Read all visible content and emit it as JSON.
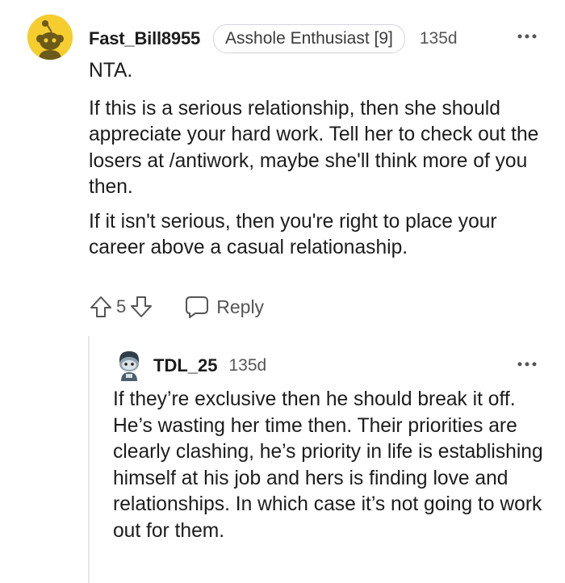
{
  "comment": {
    "username": "Fast_Bill8955",
    "flair": "Asshole Enthusiast [9]",
    "age": "135d",
    "paragraphs": [
      "NTA.",
      "If this is a serious relationship, then she should appreciate your hard work. Tell her to check out the losers at /antiwork, maybe she'll think more of you then.",
      "If it isn't serious, then you're right to place your career above a casual relationaship."
    ],
    "score": "5",
    "reply_label": "Reply"
  },
  "reply": {
    "username": "TDL_25",
    "age": "135d",
    "text": "If they’re exclusive then he should break it off. He’s wasting her time then. Their priorities are clearly clashing, he’s priority in life is establishing himself at his job and hers is finding love and relationships. In which case it’s not going to work out for them."
  },
  "icons": {
    "avatar_main": "snoo-avatar-icon",
    "avatar_reply": "snoo-avatar-icon",
    "more": "more-options-icon",
    "upvote": "upvote-arrow-icon",
    "downvote": "downvote-arrow-icon",
    "reply": "comment-bubble-icon"
  },
  "colors": {
    "avatar_bg": "#f5cd2e",
    "meta_text": "#555555",
    "thread_line": "#e4e6e8"
  }
}
